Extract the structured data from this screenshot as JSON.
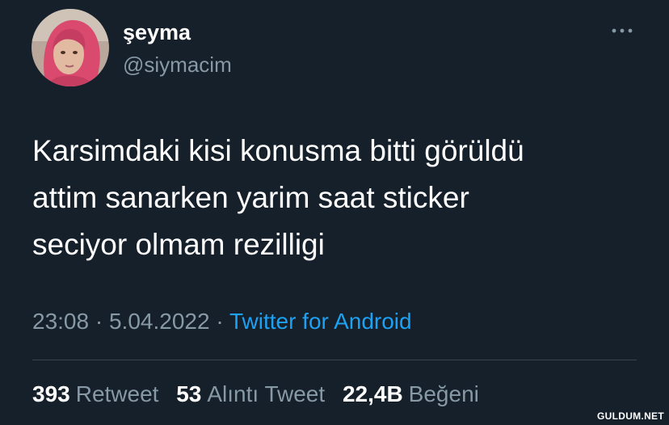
{
  "tweet": {
    "display_name": "şeyma",
    "handle": "@siymacim",
    "text_lines": [
      "Karsimdaki kisi konusma bitti görüldü",
      "attim sanarken yarim saat sticker",
      "seciyor olmam rezilligi"
    ],
    "time": "23:08",
    "separator": "·",
    "date": "5.04.2022",
    "source": "Twitter for Android",
    "stats": {
      "retweets": {
        "count": "393",
        "label": "Retweet"
      },
      "quotes": {
        "count": "53",
        "label": "Alıntı Tweet"
      },
      "likes": {
        "count": "22,4B",
        "label": "Beğeni"
      }
    }
  },
  "icons": {
    "more": "more-horizontal-icon",
    "avatar": "profile-photo"
  },
  "colors": {
    "background": "#15202b",
    "primary_text": "#ffffff",
    "secondary_text": "#8899a6",
    "link": "#1da1f2",
    "divider": "#38444d",
    "avatar_hijab": "#d94a6e"
  },
  "watermark": "GULDUM.NET"
}
